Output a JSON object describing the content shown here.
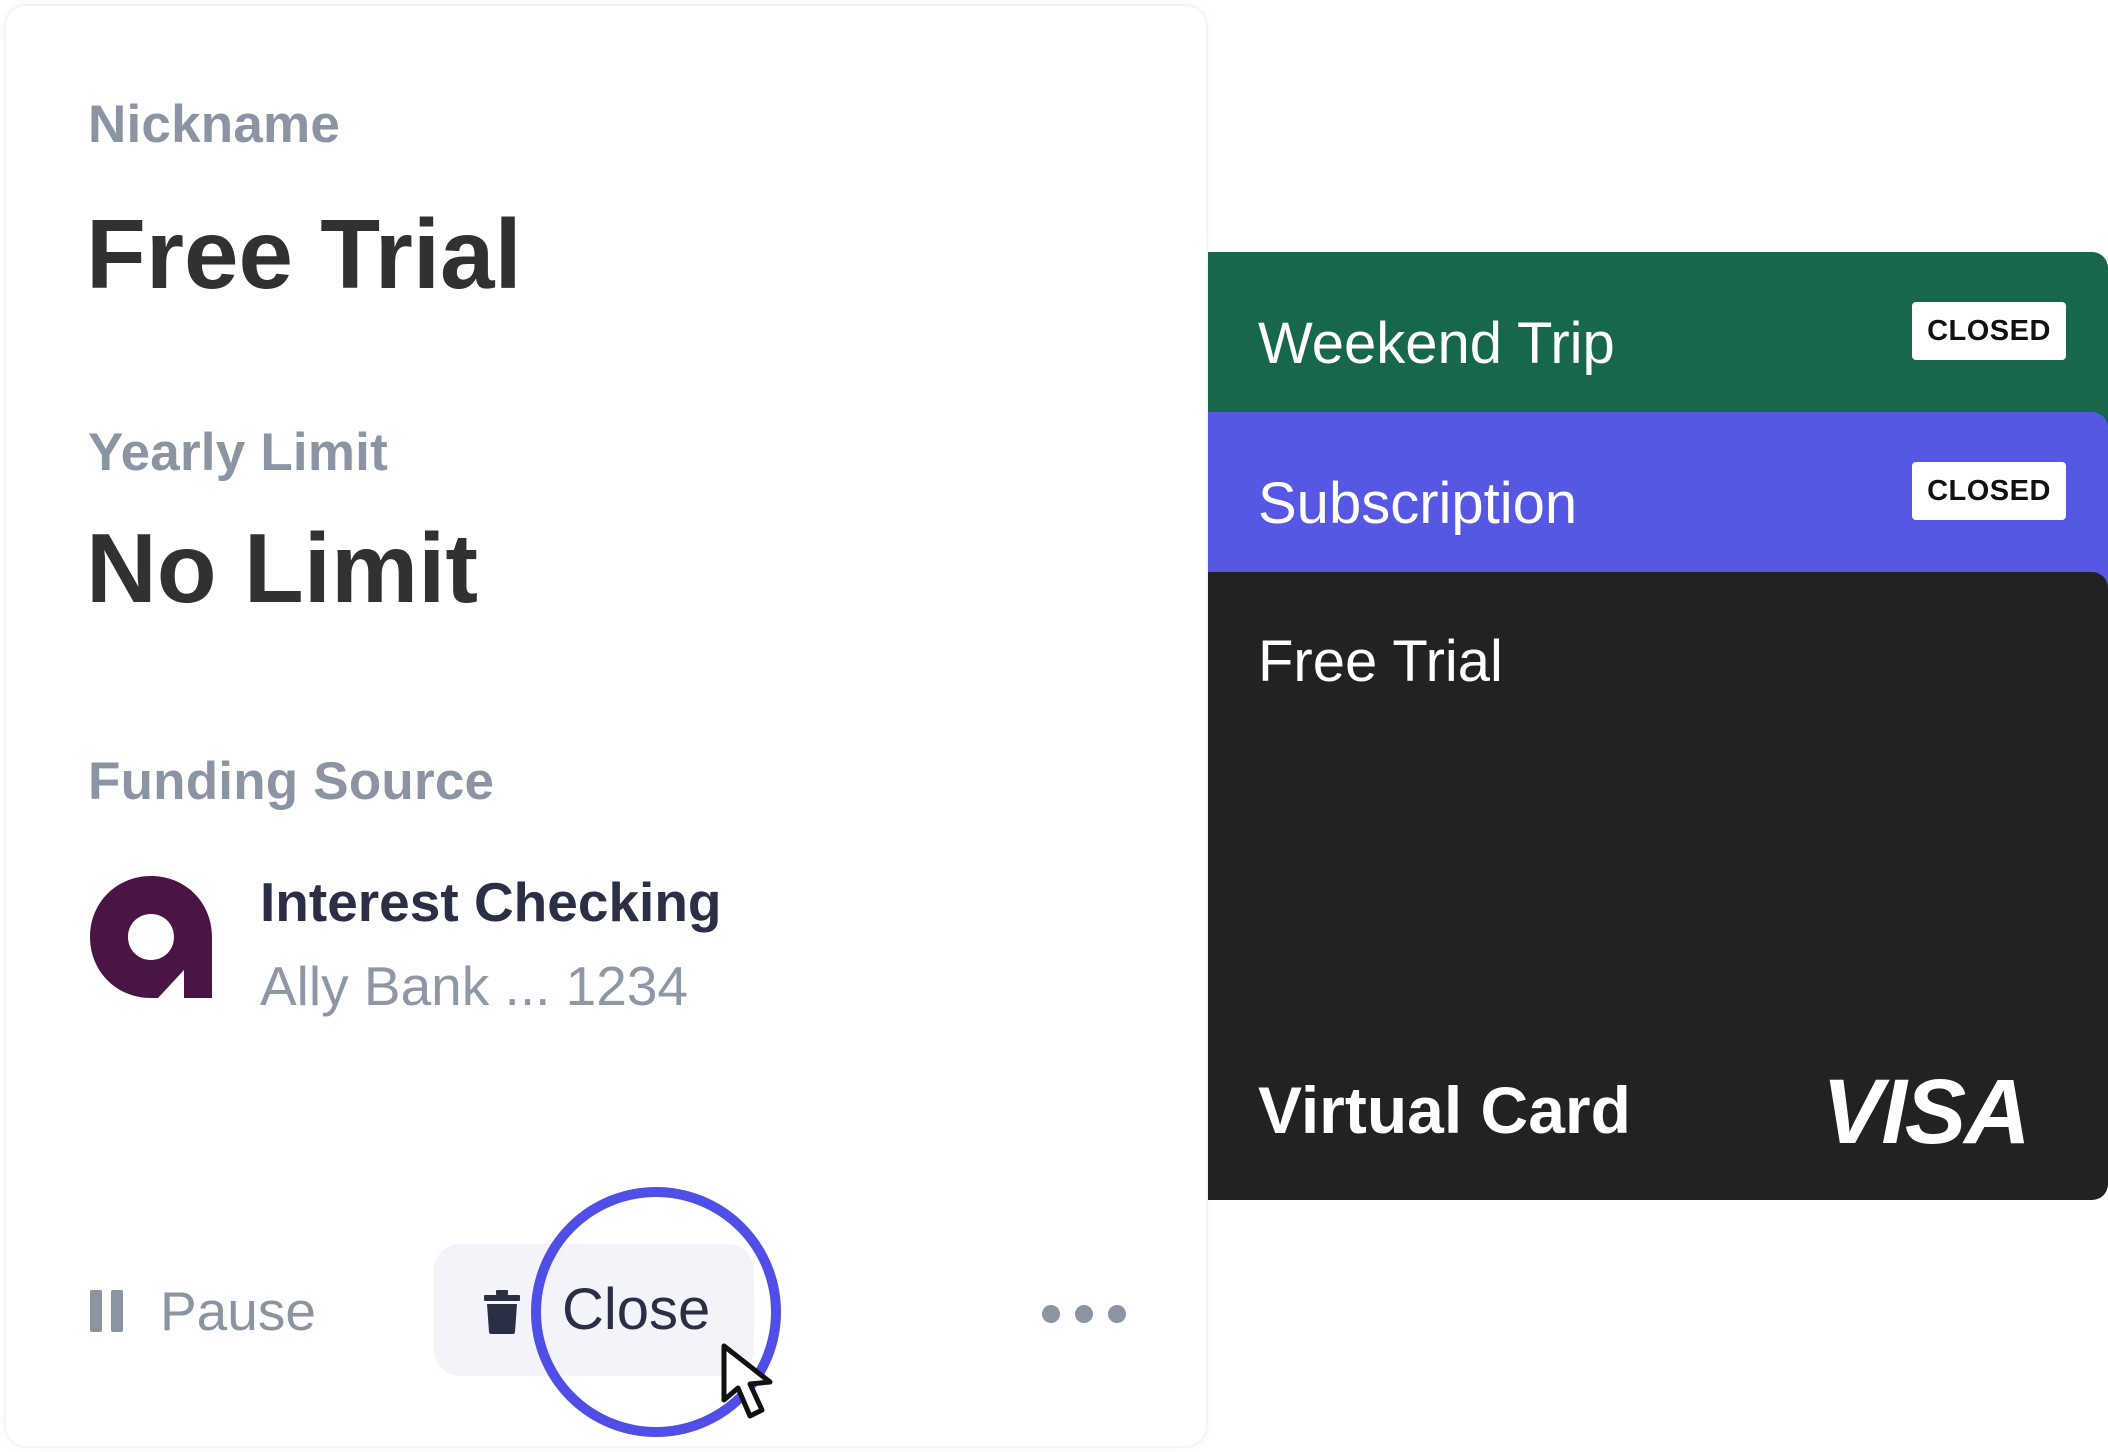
{
  "details": {
    "nickname_label": "Nickname",
    "nickname_value": "Free Trial",
    "limit_label": "Yearly Limit",
    "limit_value": "No Limit",
    "funding_label": "Funding Source",
    "account_name": "Interest Checking",
    "account_sub": "Ally Bank ... 1234",
    "bank_logo": "ally-bank-logo",
    "bank_color": "#4a1445"
  },
  "actions": {
    "pause_label": "Pause",
    "pause_icon": "pause-icon",
    "close_label": "Close",
    "close_icon": "trash-icon",
    "more_icon": "more-dots-icon",
    "focus_ring_color": "#4f4fe8"
  },
  "cards": {
    "weekend": {
      "title": "Weekend Trip",
      "status": "CLOSED",
      "color": "#17674b"
    },
    "subscription": {
      "title": "Subscription",
      "status": "CLOSED",
      "color": "#5657e2"
    },
    "main": {
      "title": "Free Trial",
      "type_label": "Virtual Card",
      "network": "VISA",
      "color": "#222222"
    }
  }
}
